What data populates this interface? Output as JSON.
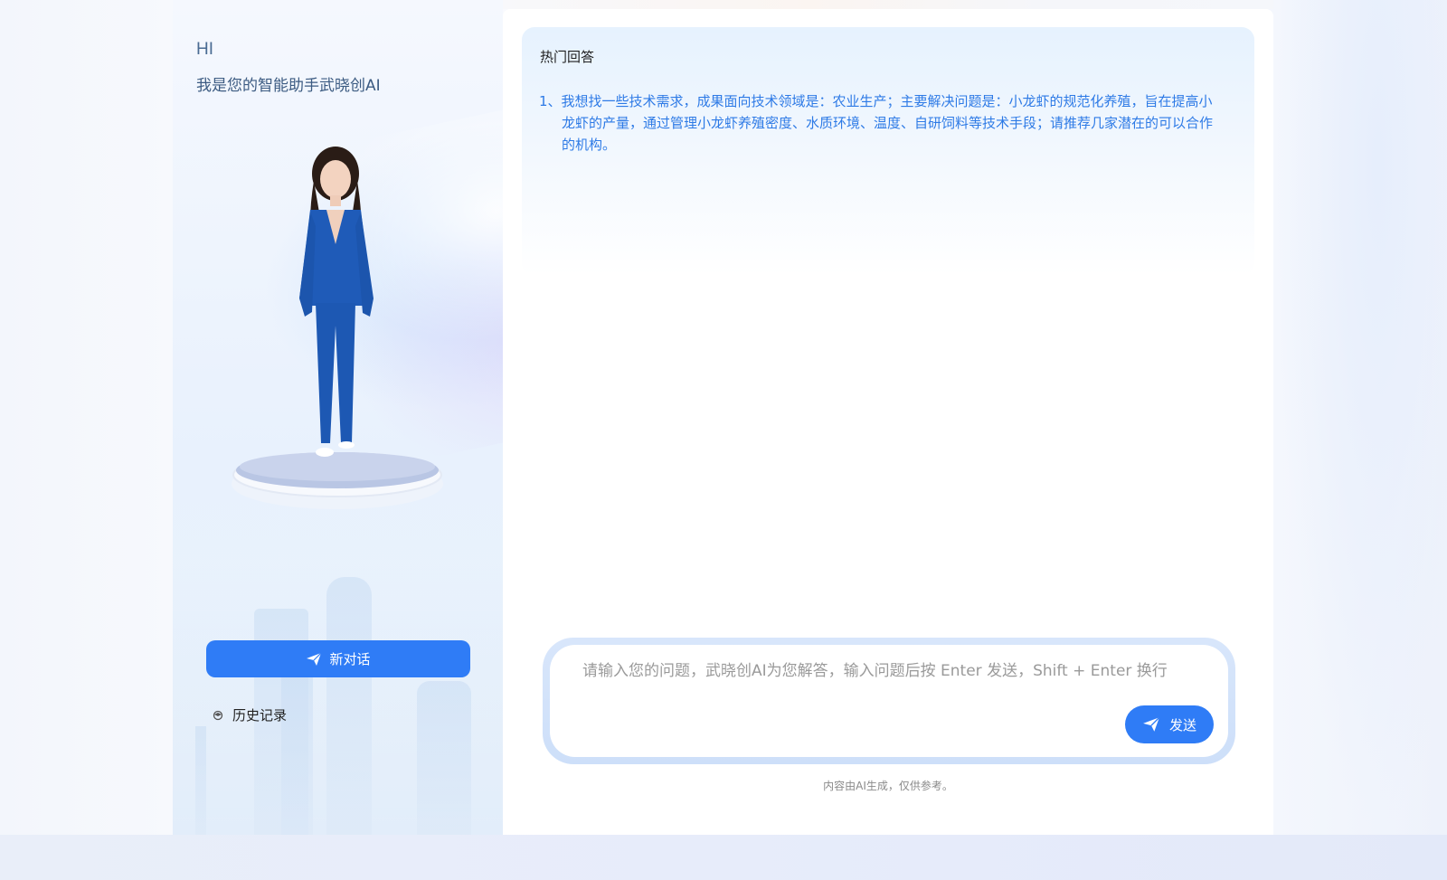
{
  "sidebar": {
    "greeting_hi": "HI",
    "greeting_sub": "我是您的智能助手武晓创AI",
    "new_chat_label": "新对话",
    "history_label": "历史记录"
  },
  "main": {
    "hot_title": "热门回答",
    "hot_items": [
      "1、我想找一些技术需求，成果面向技术领域是：农业生产；主要解决问题是：小龙虾的规范化养殖，旨在提高小龙虾的产量，通过管理小龙虾养殖密度、水质环境、温度、自研饲料等技术手段；请推荐几家潜在的可以合作的机构。"
    ],
    "input_placeholder": "请输入您的问题，武晓创AI为您解答，输入问题后按 Enter 发送，Shift + Enter 换行",
    "send_label": "发送",
    "disclaimer": "内容由AI生成，仅供参考。"
  },
  "colors": {
    "accent": "#2f7cf6",
    "link": "#2d7ae6"
  }
}
